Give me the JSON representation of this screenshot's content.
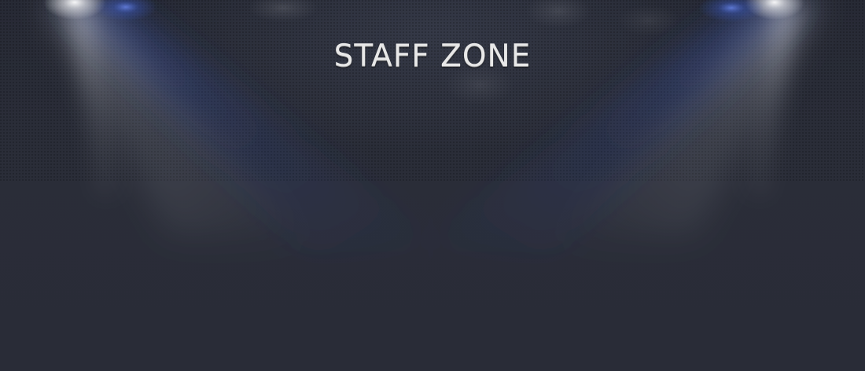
{
  "header": {
    "title": "STAFF ZONE"
  },
  "theme": {
    "background": "#292c37",
    "title_color": "#e8e8e8",
    "light_white": "#ffffff",
    "light_blue": "#3d5fd1"
  }
}
